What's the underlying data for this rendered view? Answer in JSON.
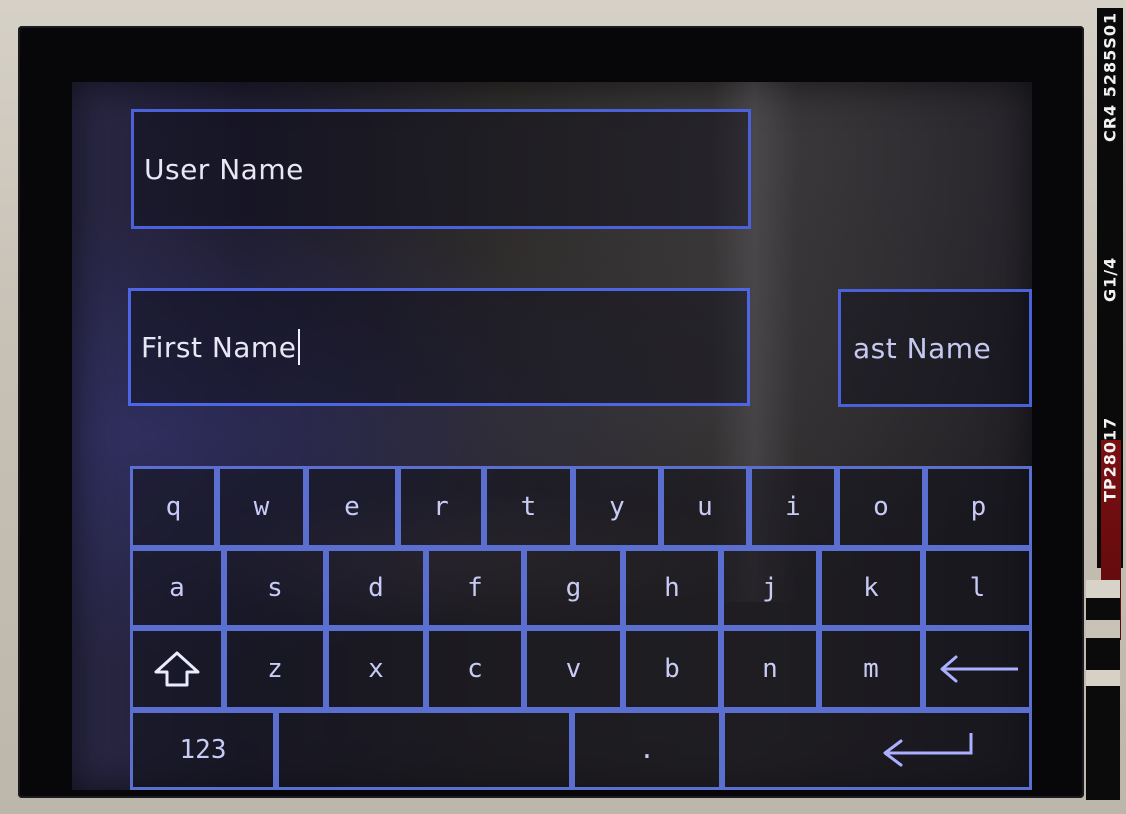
{
  "fields": {
    "user_name": {
      "text": "User Name"
    },
    "first_name": {
      "text": "First Name"
    },
    "last_name": {
      "text": "ast Name"
    }
  },
  "keyboard": {
    "row1": [
      "q",
      "w",
      "e",
      "r",
      "t",
      "y",
      "u",
      "i",
      "o",
      "p"
    ],
    "row2": [
      "a",
      "s",
      "d",
      "f",
      "g",
      "h",
      "j",
      "k",
      "l"
    ],
    "row3": {
      "letters": [
        "z",
        "x",
        "c",
        "v",
        "b",
        "n",
        "m"
      ],
      "shift_icon": "shift-arrow-up-icon",
      "backspace_icon": "arrow-left-icon"
    },
    "row4": {
      "mode_label": "123",
      "period_label": ".",
      "enter_icon": "enter-return-icon"
    }
  },
  "hardware": {
    "pcb_labels": [
      "TP28017",
      "G1/4",
      "CR4 5285S01"
    ]
  },
  "colors": {
    "field_border": "#4a61d9",
    "key_border": "#5b6fd0",
    "text_primary": "#e8e8f4",
    "text_key": "#c7cbf6"
  }
}
